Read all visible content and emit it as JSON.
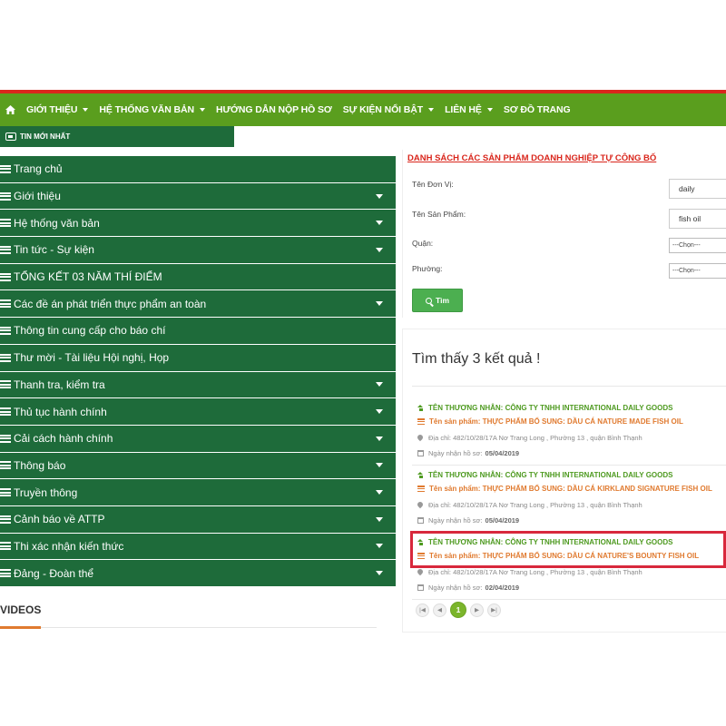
{
  "nav": {
    "items": [
      {
        "label": "GIỚI THIỆU",
        "dropdown": true
      },
      {
        "label": "HỆ THỐNG VĂN BẢN",
        "dropdown": true
      },
      {
        "label": "HƯỚNG DẪN NỘP HỒ SƠ",
        "dropdown": false
      },
      {
        "label": "SỰ KIỆN NỔI BẬT",
        "dropdown": true
      },
      {
        "label": "LIÊN HỆ",
        "dropdown": true
      },
      {
        "label": "SƠ ĐỒ TRANG",
        "dropdown": false
      }
    ],
    "color": "#5a9e1e",
    "stripe_color": "#d9261c"
  },
  "news_tab": {
    "label": "TIN MỚI NHẤT"
  },
  "sidebar": {
    "color": "#1e6b3a",
    "items": [
      {
        "label": "Trang chủ",
        "dropdown": false
      },
      {
        "label": "Giới thiệu",
        "dropdown": true
      },
      {
        "label": "Hệ thống văn bản",
        "dropdown": true
      },
      {
        "label": "Tin tức - Sự kiện",
        "dropdown": true
      },
      {
        "label": "TỔNG KẾT 03 NĂM THÍ ĐIỂM",
        "dropdown": false
      },
      {
        "label": "Các đề án phát triển thực phẩm an toàn",
        "dropdown": true
      },
      {
        "label": "Thông tin cung cấp cho báo chí",
        "dropdown": false
      },
      {
        "label": "Thư mời - Tài liệu Hội nghị, Họp",
        "dropdown": false
      },
      {
        "label": "Thanh tra, kiểm tra",
        "dropdown": true
      },
      {
        "label": "Thủ tục hành chính",
        "dropdown": true
      },
      {
        "label": "Cải cách hành chính",
        "dropdown": true
      },
      {
        "label": "Thông báo",
        "dropdown": true
      },
      {
        "label": "Truyền thông",
        "dropdown": true
      },
      {
        "label": "Cảnh báo về ATTP",
        "dropdown": true
      },
      {
        "label": "Thi xác nhận kiến thức",
        "dropdown": true
      },
      {
        "label": "Đảng - Đoàn thể",
        "dropdown": true
      }
    ]
  },
  "videos": {
    "title": "VIDEOS"
  },
  "search": {
    "title": "DANH SÁCH CÁC SẢN PHẨM DOANH NGHIỆP TỰ CÔNG BỐ",
    "unit_label": "Tên Đơn Vị:",
    "unit_value": "daily",
    "product_label": "Tên Sản Phẩm:",
    "product_value": "fish oil",
    "district_label": "Quận:",
    "district_value": "---Chọn---",
    "ward_label": "Phường:",
    "ward_value": "---Chọn---",
    "button_label": "Tìm"
  },
  "results": {
    "heading": "Tìm thấy 3 kết quả !",
    "items": [
      {
        "merchant": "TÊN THƯƠNG NHÂN: CÔNG TY TNHH INTERNATIONAL DAILY GOODS",
        "product": "Tên sản phẩm: THỰC PHẨM BỔ SUNG: DẦU CÁ NATURE MADE FISH OIL",
        "address": "Địa chỉ: 482/10/28/17A Nơ Trang Long , Phường 13 , quận Bình Thạnh",
        "date_label": "Ngày nhận hồ sơ:",
        "date": "05/04/2019"
      },
      {
        "merchant": "TÊN THƯƠNG NHÂN: CÔNG TY TNHH INTERNATIONAL DAILY GOODS",
        "product": "Tên sản phẩm: THỰC PHẨM BỔ SUNG: DẦU CÁ KIRKLAND SIGNATURE FISH OIL",
        "address": "Địa chỉ: 482/10/28/17A Nơ Trang Long , Phường 13 , quận Bình Thạnh",
        "date_label": "Ngày nhận hồ sơ:",
        "date": "05/04/2019"
      },
      {
        "merchant": "TÊN THƯƠNG NHÂN: CÔNG TY TNHH INTERNATIONAL DAILY GOODS",
        "product": "Tên sản phẩm: THỰC PHẨM BỔ SUNG: DẦU CÁ NATURE'S BOUNTY FISH OIL",
        "address": "Địa chỉ: 482/10/28/17A Nơ Trang Long , Phường 13 , quận Bình Thạnh",
        "date_label": "Ngày nhận hồ sơ:",
        "date": "02/04/2019"
      }
    ],
    "highlighted_index": 2,
    "highlight_color": "#d8283c"
  },
  "pagination": {
    "first": "|◀",
    "prev": "◀",
    "current": "1",
    "next": "▶",
    "last": "▶|"
  }
}
